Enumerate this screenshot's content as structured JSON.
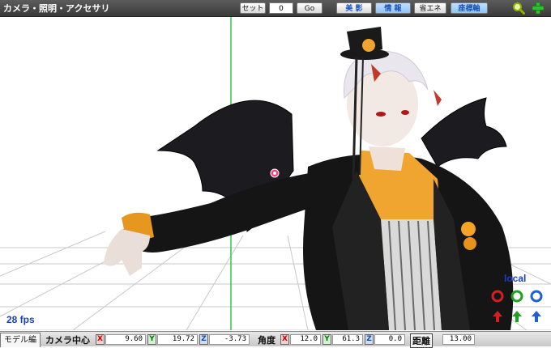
{
  "toolbar": {
    "title": "カメラ・照明・アクセサリ",
    "set_label": "セット",
    "frame_value": "0",
    "go_label": "Go",
    "beauty_label": "美 影",
    "info_label": "情 報",
    "power_save_label": "省エネ",
    "axis_label": "座標軸",
    "search_icon": "magnifier-icon",
    "add_icon": "green-plus-icon"
  },
  "viewport": {
    "fps": "28 fps",
    "local_label": "local",
    "colors": {
      "grid": "#c8c8c8",
      "axis_line": "#2ecc40"
    }
  },
  "bottom": {
    "tab_label": "モデル編",
    "camera_center_label": "カメラ中心",
    "center": {
      "x": "9.60",
      "y": "19.72",
      "z": "-3.73"
    },
    "angle_label": "角度",
    "angle": {
      "x": "12.0",
      "y": "61.3",
      "z": "0.0"
    },
    "distance_label": "距離",
    "distance": "13.00",
    "axis_letters": {
      "x": "X",
      "y": "Y",
      "z": "Z"
    }
  }
}
